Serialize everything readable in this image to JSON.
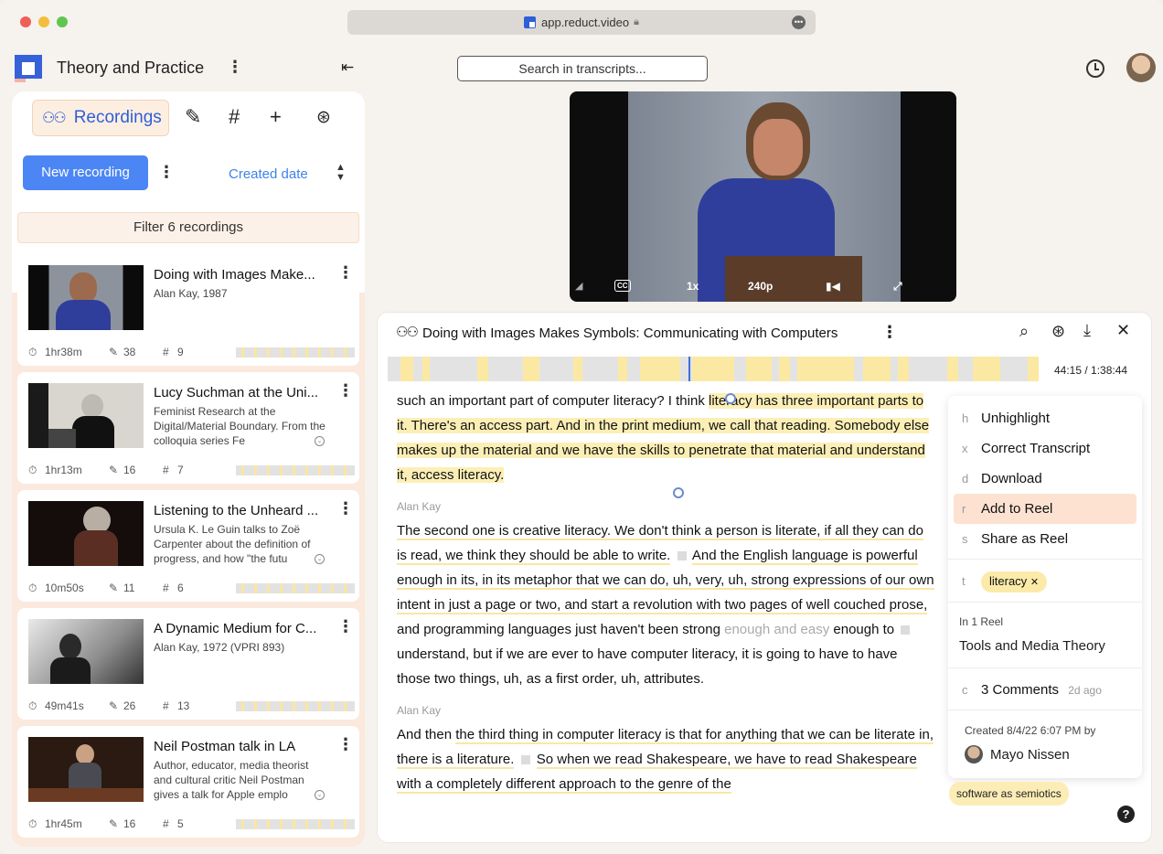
{
  "browser": {
    "url": "app.reduct.video"
  },
  "header": {
    "project_title": "Theory and Practice",
    "search_placeholder": "Search in transcripts..."
  },
  "sidebar": {
    "tabs": {
      "recordings_label": "Recordings"
    },
    "new_recording_label": "New recording",
    "sort_label": "Created date",
    "filter_label": "Filter 6 recordings",
    "recordings": [
      {
        "title": "Doing with Images Make...",
        "subtitle": "Alan Kay, 1987",
        "duration": "1hr38m",
        "highlights": "38",
        "tags": "9"
      },
      {
        "title": "Lucy Suchman at the Uni...",
        "subtitle": "Feminist Research at the Digital/Material Boundary. From the colloquia series Fe",
        "duration": "1hr13m",
        "highlights": "16",
        "tags": "7"
      },
      {
        "title": "Listening to the Unheard ...",
        "subtitle": "Ursula K. Le Guin talks to Zoë Carpenter about the definition of progress, and how \"the futu",
        "duration": "10m50s",
        "highlights": "11",
        "tags": "6"
      },
      {
        "title": "A Dynamic Medium for C...",
        "subtitle": "Alan Kay, 1972 (VPRI 893)",
        "duration": "49m41s",
        "highlights": "26",
        "tags": "13"
      },
      {
        "title": "Neil Postman talk in LA",
        "subtitle": "Author, educator, media theorist and cultural critic Neil Postman gives a talk for Apple emplo",
        "duration": "1hr45m",
        "highlights": "16",
        "tags": "5"
      }
    ]
  },
  "video": {
    "cc": "CC",
    "speed": "1x",
    "quality": "240p"
  },
  "panel": {
    "title": "Doing with Images Makes Symbols: Communicating with Computers",
    "timecode": "44:15 / 1:38:44",
    "transcript": {
      "p1_pre": "such an important part of computer literacy? I think ",
      "p1_hl": "literacy has three important parts to it. There's an access part. And in the print medium, we call that reading. Somebody else makes up the material and we have the skills to penetrate that material and understand it, access literacy.",
      "speaker2": "Alan Kay",
      "p2_a": "The second one is creative literacy. We don't think a person is literate, if all they can do is read, we think they should be able to write.",
      "p2_b": "And the English language is powerful enough in its, in its metaphor that we can do, uh, very, uh, strong expressions of our own intent in just a page or two, and start a revolution with two pages of well couched prose,",
      "p2_c": " and programming languages just haven't been strong ",
      "p2_muted": "enough and easy",
      "p2_d": " enough to ",
      "p2_e": " understand, but if we are ever to have computer literacy, it is going to have to have those two things, uh, as a first order, uh, attributes.",
      "speaker3": "Alan Kay",
      "p3_a": "And then ",
      "p3_b": "the third thing in computer literacy is that for anything that we can be literate in, there is a literature.",
      "p3_c": " So when we read Shakespeare, we have to read Shakespeare with a completely different approach to the genre of the"
    },
    "menu": {
      "items": [
        {
          "key": "h",
          "label": "Unhighlight"
        },
        {
          "key": "x",
          "label": "Correct Transcript"
        },
        {
          "key": "d",
          "label": "Download"
        },
        {
          "key": "r",
          "label": "Add to Reel"
        },
        {
          "key": "s",
          "label": "Share as Reel"
        }
      ],
      "tag_key": "t",
      "tag_label": "literacy",
      "reel_count_label": "In 1 Reel",
      "reel_name": "Tools and Media Theory",
      "comments_key": "c",
      "comments_label": "3 Comments",
      "comments_age": "2d ago",
      "created_label": "Created 8/4/22 6:07 PM by",
      "author": "Mayo Nissen"
    },
    "floating_tag": "software as semiotics"
  },
  "colors": {
    "accent": "#2f5fd6",
    "button": "#4c86f5",
    "highlight": "#fcefb6",
    "active_menu": "#fde2d2"
  }
}
